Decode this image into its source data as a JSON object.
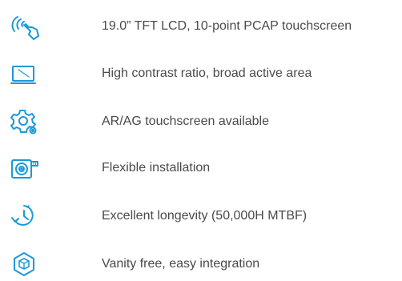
{
  "accent_color": "#1a9ad6",
  "features": [
    {
      "icon": "touch-gesture-icon",
      "label": "19.0” TFT LCD, 10-point PCAP touchscreen"
    },
    {
      "icon": "monitor-icon",
      "label": "High contrast ratio, broad active area"
    },
    {
      "icon": "gear-settings-icon",
      "label": "AR/AG touchscreen available"
    },
    {
      "icon": "installation-icon",
      "label": "Flexible installation"
    },
    {
      "icon": "timer-longevity-icon",
      "label": "Excellent longevity (50,000H MTBF)"
    },
    {
      "icon": "cube-integration-icon",
      "label": "Vanity free, easy integration"
    }
  ]
}
